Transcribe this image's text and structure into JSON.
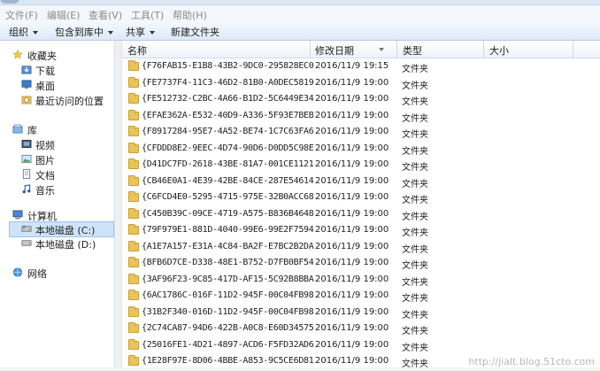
{
  "menu": [
    "文件(F)",
    "编辑(E)",
    "查看(V)",
    "工具(T)",
    "帮助(H)"
  ],
  "toolbar": {
    "organize": "组织",
    "include_library": "包含到库中",
    "share": "共享",
    "new_folder": "新建文件夹"
  },
  "nav": {
    "favorites": "收藏夹",
    "downloads": "下载",
    "desktop": "桌面",
    "recent": "最近访问的位置",
    "libraries": "库",
    "videos": "视频",
    "pictures": "图片",
    "documents": "文档",
    "music": "音乐",
    "computer": "计算机",
    "drive_c": "本地磁盘 (C:)",
    "drive_d": "本地磁盘 (D:)",
    "network": "网络"
  },
  "columns": {
    "name": "名称",
    "modified": "修改日期",
    "type": "类型",
    "size": "大小"
  },
  "files": [
    {
      "name": "{F76FAB15-E1B8-43B2-9DC0-295828EC0...",
      "date": "2016/11/9 19:15",
      "type": "文件夹"
    },
    {
      "name": "{FE7737F4-11C3-46D2-81B0-A0DEC5819...",
      "date": "2016/11/9 19:00",
      "type": "文件夹"
    },
    {
      "name": "{FE512732-C2BC-4A66-B1D2-5C6449E34...",
      "date": "2016/11/9 19:00",
      "type": "文件夹"
    },
    {
      "name": "{EFAE362A-E532-40D9-A336-5F93E7BEB...",
      "date": "2016/11/9 19:00",
      "type": "文件夹"
    },
    {
      "name": "{F8917284-95E7-4A52-BE74-1C7C63FA6...",
      "date": "2016/11/9 19:00",
      "type": "文件夹"
    },
    {
      "name": "{CFDDD8E2-9EEC-4D74-90D6-D0DD5C98E...",
      "date": "2016/11/9 19:00",
      "type": "文件夹"
    },
    {
      "name": "{D41DC7FD-2618-43BE-81A7-001CE1121...",
      "date": "2016/11/9 19:00",
      "type": "文件夹"
    },
    {
      "name": "{CB46E0A1-4E39-42BE-84CE-287E54614...",
      "date": "2016/11/9 19:00",
      "type": "文件夹"
    },
    {
      "name": "{C6FCD4E0-5295-4715-975E-32B0ACC68...",
      "date": "2016/11/9 19:00",
      "type": "文件夹"
    },
    {
      "name": "{C450B39C-09CE-4719-A575-B836B4648...",
      "date": "2016/11/9 19:00",
      "type": "文件夹"
    },
    {
      "name": "{79F979E1-881D-4040-99E6-99E2F7594...",
      "date": "2016/11/9 19:00",
      "type": "文件夹"
    },
    {
      "name": "{A1E7A157-E31A-4C84-BA2F-E7BC2B2DA...",
      "date": "2016/11/9 19:00",
      "type": "文件夹"
    },
    {
      "name": "{BFB6D7CE-D338-48E1-B752-D7FB0BF54...",
      "date": "2016/11/9 19:00",
      "type": "文件夹"
    },
    {
      "name": "{3AF96F23-9C85-417D-AF15-5C92B8BBA...",
      "date": "2016/11/9 19:00",
      "type": "文件夹"
    },
    {
      "name": "{6AC1786C-016F-11D2-945F-00C04FB98...",
      "date": "2016/11/9 19:00",
      "type": "文件夹"
    },
    {
      "name": "{31B2F340-016D-11D2-945F-00C04FB98...",
      "date": "2016/11/9 19:00",
      "type": "文件夹"
    },
    {
      "name": "{2C74CA87-94D6-422B-A0C8-E60D34575...",
      "date": "2016/11/9 19:00",
      "type": "文件夹"
    },
    {
      "name": "{25016FE1-4D21-4897-ACD6-F5FD32AD6...",
      "date": "2016/11/9 19:00",
      "type": "文件夹"
    },
    {
      "name": "{1E28F97E-8D06-4BBE-A853-9C5CE6D81...",
      "date": "2016/11/9 19:00",
      "type": "文件夹"
    }
  ],
  "watermark": "http://jialt.blog.51cto.com"
}
